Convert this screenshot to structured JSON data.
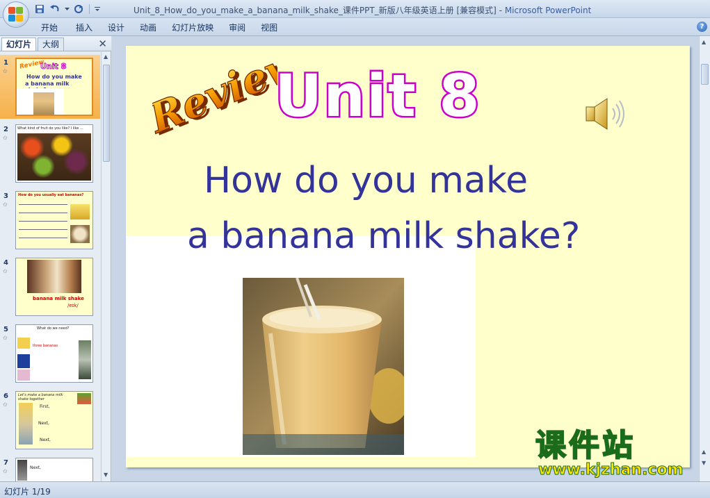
{
  "window": {
    "title": "Unit_8_How_do_you_make_a_banana_milk_shake_课件PPT_新版八年级英语上册 [兼容模式]",
    "app_separator": " - ",
    "app_name": "Microsoft PowerPoint"
  },
  "ribbon": {
    "tabs": [
      "开始",
      "插入",
      "设计",
      "动画",
      "幻灯片放映",
      "审阅",
      "视图"
    ],
    "help": "?"
  },
  "left_pane": {
    "tab_slides": "幻灯片",
    "tab_outline": "大纲",
    "close": "✕",
    "thumbnails": [
      {
        "num": "1",
        "line1": "Unit 8",
        "line2": "How do you make",
        "line3": "a banana milk shake?"
      },
      {
        "num": "2",
        "line1": "What kind of fruit do you like? I like ..."
      },
      {
        "num": "3",
        "line1": "How do you usually eat bananas?"
      },
      {
        "num": "4",
        "line1": "banana milk shake",
        "line2": "/eɪk/"
      },
      {
        "num": "5",
        "line1": "What do we need?",
        "line2": "three bananas"
      },
      {
        "num": "6",
        "line1": "Let's make a banana milk shake together",
        "line2": "First,",
        "line3": "Next,",
        "line4": "Next,"
      },
      {
        "num": "7",
        "line1": "Next,"
      }
    ]
  },
  "slide": {
    "review_word": "Review",
    "unit_title": "Unit 8",
    "question_line1": "How do you make",
    "question_line2": "a banana milk shake?"
  },
  "watermark": {
    "cn": "课件站",
    "url": "www.kjzhan.com"
  },
  "status": {
    "slide_counter": "幻灯片 1/19"
  },
  "colors": {
    "slide_bg": "#ffffcc",
    "unit_outline": "#cc00cc",
    "question_text": "#333399",
    "review_fill": "#f07a00",
    "selected_thumb": "#f6b14a"
  },
  "icons": [
    "office-button-icon",
    "save-icon",
    "undo-icon",
    "redo-icon",
    "customize-qat-icon",
    "help-icon",
    "close-pane-icon",
    "speaker-icon"
  ]
}
